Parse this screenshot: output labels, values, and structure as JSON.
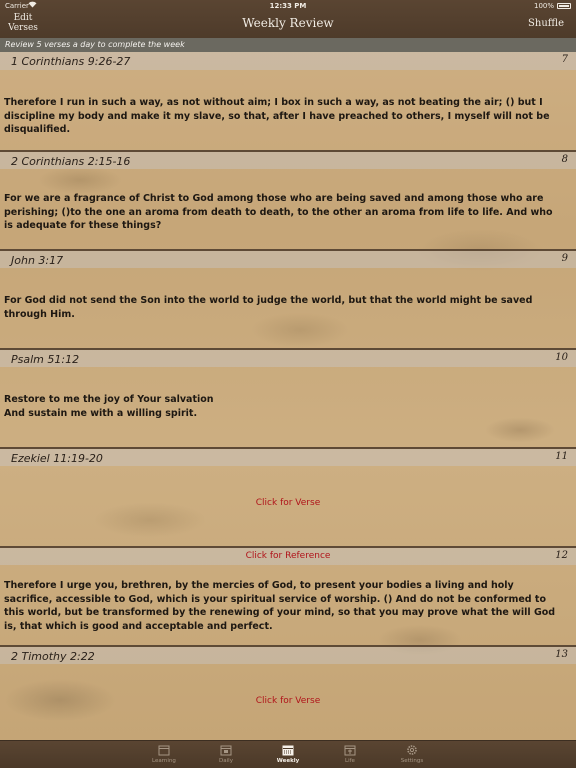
{
  "status": {
    "carrier": "Carrier",
    "time": "12:33 PM",
    "battery": "100%"
  },
  "nav": {
    "left_line1": "Edit",
    "left_line2": "Verses",
    "title": "Weekly Review",
    "right": "Shuffle"
  },
  "info": "Review 5 verses a day to complete the week",
  "cards": [
    {
      "reference": "1 Corinthians 9:26-27",
      "number": "7",
      "verse": "Therefore I run in such a way, as not without aim; I box in such a way, as not beating the air; () but I discipline my body and make it my slave, so that, after I have preached to others, I myself will not be disqualified."
    },
    {
      "reference": "2 Corinthians 2:15-16",
      "number": "8",
      "verse": "For we are a fragrance of Christ to God among those who are being saved and among those who are perishing; ()to the one an aroma from death to death, to the other an aroma from life to life. And who is adequate for these things?"
    },
    {
      "reference": "John 3:17",
      "number": "9",
      "verse": "For God did not send the Son into the world to judge the world, but that the world might be saved through Him."
    },
    {
      "reference": "Psalm 51:12",
      "number": "10",
      "verse": "Restore to me the joy of Your salvation\nAnd sustain me with a willing spirit."
    },
    {
      "reference": "Ezekiel 11:19-20",
      "number": "11",
      "click_verse": "Click for Verse"
    },
    {
      "click_reference": "Click for Reference",
      "number": "12",
      "verse": "Therefore I urge you, brethren, by the mercies of God, to present your bodies a living and holy sacrifice, accessible to God, which is your spiritual service of worship. () And do not be conformed to this world, but be transformed by the renewing of your mind, so that you may prove what the will God is, that which is good and acceptable and perfect."
    },
    {
      "reference": "2 Timothy 2:22",
      "number": "13",
      "click_verse": "Click for Verse"
    }
  ],
  "tabs": [
    {
      "label": "Learning",
      "icon": "calendar-icon"
    },
    {
      "label": "Daily",
      "icon": "calendar-day-icon"
    },
    {
      "label": "Weekly",
      "icon": "calendar-week-icon"
    },
    {
      "label": "Life",
      "icon": "calendar-life-icon"
    },
    {
      "label": "Settings",
      "icon": "gear-icon"
    }
  ],
  "active_tab": "Weekly",
  "colors": {
    "bar": "#4e3b2a",
    "link_red": "#b0141a",
    "info_bar": "#6b6960"
  }
}
